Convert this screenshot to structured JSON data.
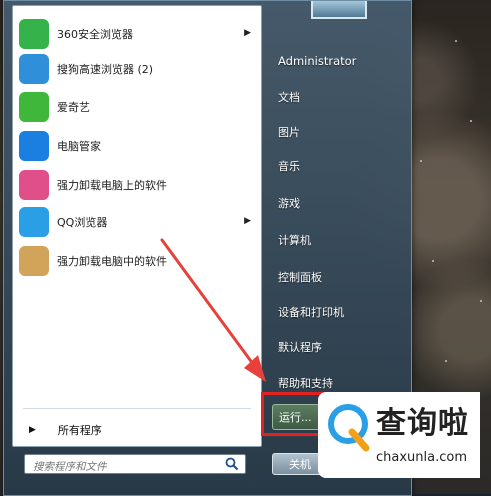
{
  "left_pane": {
    "apps": [
      {
        "label": "360安全浏览器",
        "has_submenu": true,
        "icon": "360-browser-icon",
        "color": "#36b24a"
      },
      {
        "label": "搜狗高速浏览器 (2)",
        "has_submenu": false,
        "icon": "sogou-browser-icon",
        "color": "#2f8fd8"
      },
      {
        "label": "爱奇艺",
        "has_submenu": false,
        "icon": "iqiyi-icon",
        "color": "#3fb73a"
      },
      {
        "label": "电脑管家",
        "has_submenu": false,
        "icon": "pc-manager-shield-icon",
        "color": "#1a7fe0"
      },
      {
        "label": "强力卸载电脑上的软件",
        "has_submenu": false,
        "icon": "uninstall-clover-icon",
        "color": "#e04f8a"
      },
      {
        "label": "QQ浏览器",
        "has_submenu": true,
        "icon": "qq-browser-icon",
        "color": "#2a9fe6"
      },
      {
        "label": "强力卸载电脑中的软件",
        "has_submenu": false,
        "icon": "recycle-box-icon",
        "color": "#d2a45a"
      }
    ],
    "all_programs": "所有程序",
    "search_placeholder": "搜索程序和文件"
  },
  "right_pane": {
    "user": "Administrator",
    "items": [
      "文档",
      "图片",
      "音乐",
      "游戏",
      "计算机",
      "控制面板",
      "设备和打印机",
      "默认程序",
      "帮助和支持"
    ],
    "run_label": "运行...",
    "shutdown_label": "关机"
  },
  "watermark": {
    "chars": "查询啦",
    "domain": "chaxunla.com"
  },
  "colors": {
    "highlight": "#e32121",
    "arrow": "#e8403a"
  }
}
